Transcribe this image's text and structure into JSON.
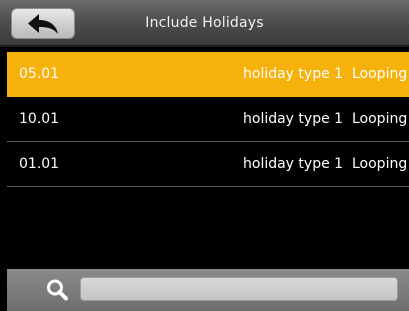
{
  "header": {
    "title": "Include Holidays",
    "back_icon": "back-arrow-icon"
  },
  "holidays": [
    {
      "date": "05.01",
      "type": "holiday type 1",
      "mode": "Looping",
      "selected": true
    },
    {
      "date": "10.01",
      "type": "holiday type 1",
      "mode": "Looping",
      "selected": false
    },
    {
      "date": "01.01",
      "type": "holiday type 1",
      "mode": "Looping",
      "selected": false
    }
  ],
  "search": {
    "icon": "search-icon",
    "value": "",
    "placeholder": ""
  },
  "colors": {
    "highlight": "#f6b20a",
    "background": "#000000",
    "text": "#ffffff"
  }
}
